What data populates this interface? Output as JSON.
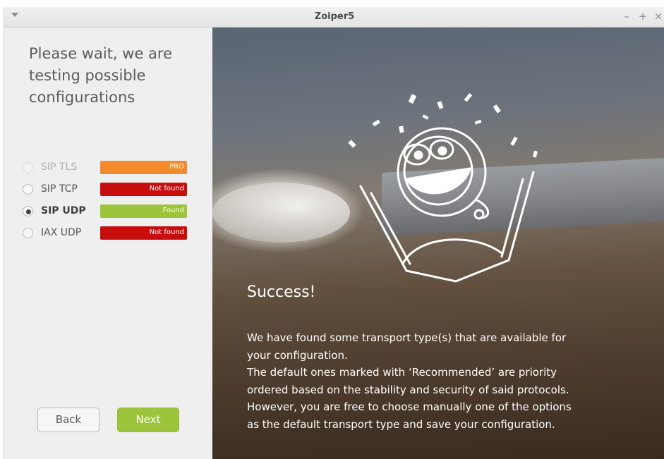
{
  "window": {
    "title": "Zoiper5",
    "controls": {
      "minimize": "–",
      "maximize": "+",
      "close": "×"
    }
  },
  "left": {
    "heading": [
      "Please wait, we are",
      "testing possible",
      "configurations"
    ],
    "transports": [
      {
        "label": "SIP TLS",
        "status": "PRO",
        "color": "#f28a2e",
        "selected": false,
        "disabled": true
      },
      {
        "label": "SIP TCP",
        "status": "Not found",
        "color": "#c80d0d",
        "selected": false,
        "disabled": false
      },
      {
        "label": "SIP UDP",
        "status": "Found",
        "color": "#9dc43b",
        "selected": true,
        "disabled": false
      },
      {
        "label": "IAX UDP",
        "status": "Not found",
        "color": "#c80d0d",
        "selected": false,
        "disabled": false
      }
    ],
    "buttons": {
      "back": "Back",
      "next": "Next"
    }
  },
  "right": {
    "success_title": "Success!",
    "description_lines": [
      "We have found some transport type(s) that are available for",
      "your configuration.",
      "The default ones marked with ‘Recommended’ are priority",
      "ordered based on the stability and security of said protocols.",
      "However, you are free to choose manually one of the options",
      "as the default  transport type and save your configuration."
    ]
  },
  "colors": {
    "accent_green": "#9dc43b",
    "error_red": "#c80d0d",
    "pro_orange": "#f28a2e"
  }
}
